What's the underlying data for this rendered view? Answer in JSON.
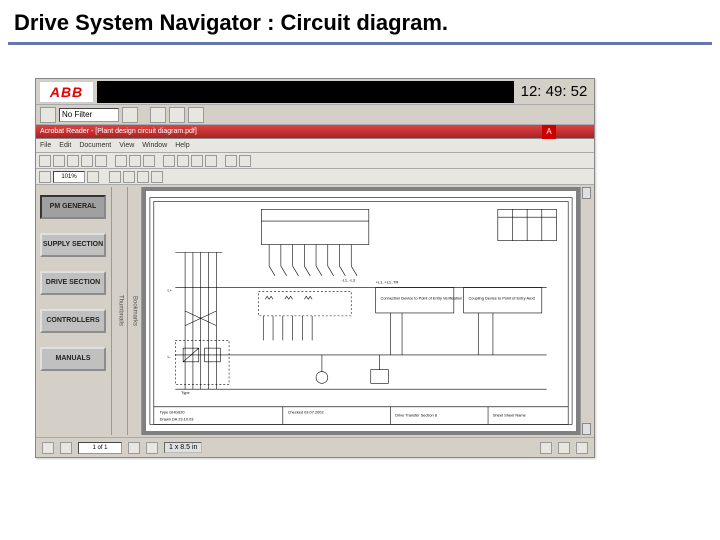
{
  "page_title": "Drive System Navigator : Circuit diagram.",
  "logo_text": "ABB",
  "clock": "12: 49: 52",
  "toolbar": {
    "filter_label": "No Filter"
  },
  "tab_strip": {
    "doc_title": "Acrobat Reader - [Plant design circuit diagram.pdf]"
  },
  "menubar": {
    "items": [
      "File",
      "Edit",
      "Document",
      "View",
      "Window",
      "Help"
    ]
  },
  "pdf_toolbar": {
    "zoom": "101%"
  },
  "thumbnails_label": "Thumbnails",
  "bookmarks_label": "Bookmarks",
  "sidebar": {
    "items": [
      {
        "label": "PM GENERAL",
        "active": true
      },
      {
        "label": "SUPPLY SECTION",
        "active": false
      },
      {
        "label": "DRIVE SECTION",
        "active": false
      },
      {
        "label": "CONTROLLERS",
        "active": false
      },
      {
        "label": "MANUALS",
        "active": false
      }
    ]
  },
  "statusbar": {
    "page": "1 of 1",
    "size": "1 x 8.5 in"
  },
  "adobe_icon": "A",
  "diagram": {
    "title_block": {
      "type": "Type GHG920",
      "drawn": "Drawn DA 23.10.03",
      "checked": "Checked 03.07.2002",
      "name": "Drive Transfer Section 8",
      "sheet": "Sheet Sheet Name"
    },
    "top_signals": [
      "",
      "",
      "",
      "",
      "",
      "",
      ""
    ],
    "left_signals": [
      "",
      "",
      "",
      "",
      ""
    ],
    "module_a": "Connection Device to Point of Entry Verification",
    "module_b": "Coupling Device to Point of Entry Aux2",
    "bus_labels": [
      "L+",
      "L-"
    ],
    "box_label": "Type"
  }
}
